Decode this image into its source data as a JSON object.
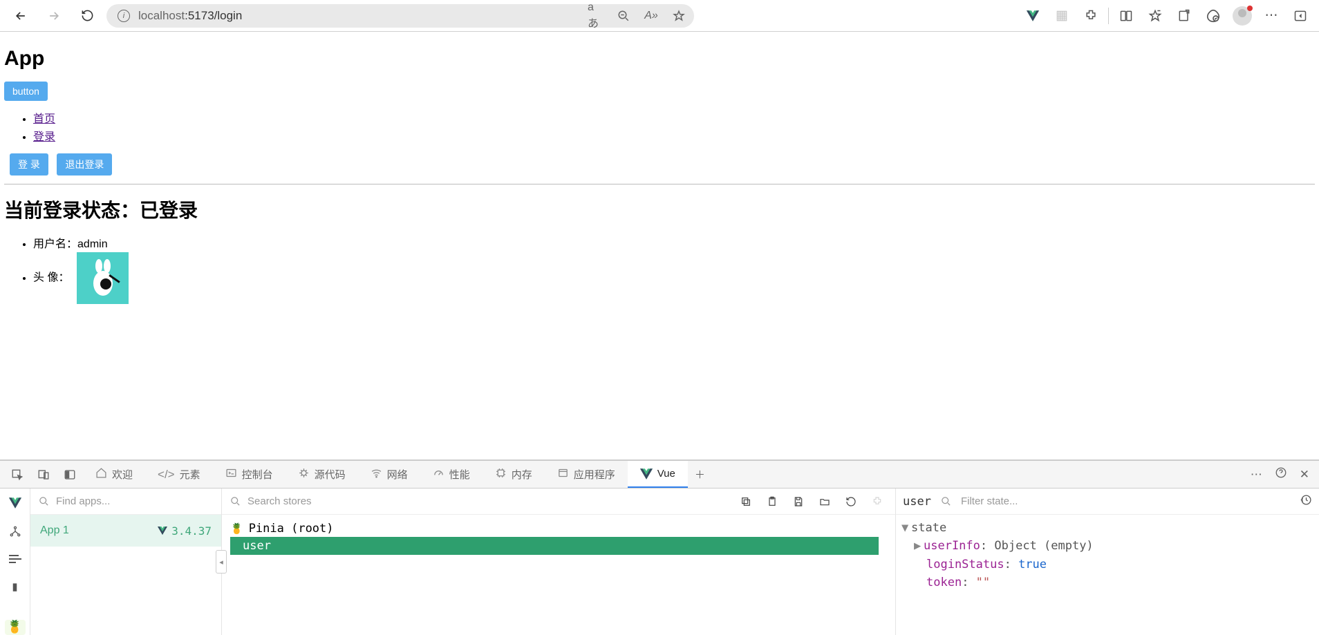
{
  "browser": {
    "url_host": "localhost",
    "url_rest": ":5173/login"
  },
  "page": {
    "title": "App",
    "button_label": "button",
    "nav": [
      "首页",
      "登录"
    ],
    "login_btn": "登 录",
    "logout_btn": "退出登录",
    "status_heading": "当前登录状态：已登录",
    "username_label": "用户名：",
    "username_value": "admin",
    "avatar_label": "头 像："
  },
  "devtools": {
    "tabs": {
      "welcome": "欢迎",
      "elements": "元素",
      "console": "控制台",
      "sources": "源代码",
      "network": "网络",
      "performance": "性能",
      "memory": "内存",
      "application": "应用程序",
      "vue": "Vue"
    },
    "apps": {
      "search_placeholder": "Find apps...",
      "app_name": "App 1",
      "vue_version": "3.4.37"
    },
    "stores": {
      "search_placeholder": "Search stores",
      "root": "Pinia (root)",
      "selected": "user"
    },
    "state": {
      "store_name": "user",
      "filter_placeholder": "Filter state...",
      "root_key": "state",
      "userInfo_key": "userInfo",
      "userInfo_value": "Object (empty)",
      "loginStatus_key": "loginStatus",
      "loginStatus_value": "true",
      "token_key": "token",
      "token_value": "\"\""
    }
  }
}
